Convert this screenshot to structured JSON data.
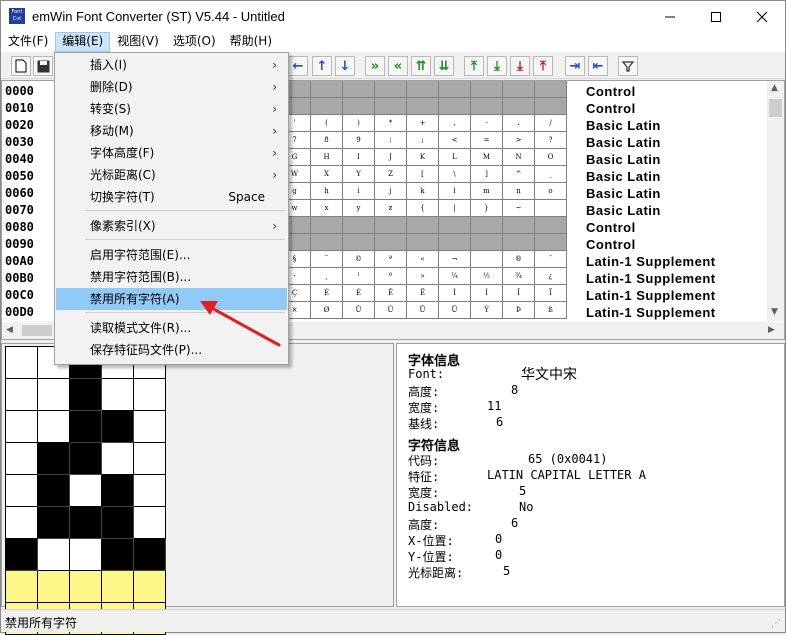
{
  "window": {
    "title": "emWin Font Converter (ST) V5.44 - Untitled",
    "icon_text": "Font Cvt"
  },
  "menubar": [
    "文件(F)",
    "编辑(E)",
    "视图(V)",
    "选项(O)",
    "帮助(H)"
  ],
  "dropdown": {
    "items": [
      {
        "label": "插入(I)",
        "submenu": true
      },
      {
        "label": "删除(D)",
        "submenu": true
      },
      {
        "label": "转变(S)",
        "submenu": true
      },
      {
        "label": "移动(M)",
        "submenu": true
      },
      {
        "label": "字体高度(F)",
        "submenu": true
      },
      {
        "label": "光标距离(C)",
        "submenu": true
      },
      {
        "label": "切换字符(T)",
        "shortcut": "Space"
      },
      {
        "label": "像素索引(X)",
        "submenu": true
      },
      {
        "label": "启用字符范围(E)..."
      },
      {
        "label": "禁用字符范围(B)..."
      },
      {
        "label": "禁用所有字符(A)",
        "highlighted": true
      },
      {
        "label": "读取模式文件(R)..."
      },
      {
        "label": "保存特征码文件(P)..."
      }
    ]
  },
  "grid": {
    "codes": [
      "0000",
      "0010",
      "0020",
      "0030",
      "0040",
      "0050",
      "0060",
      "0070",
      "0080",
      "0090",
      "00A0",
      "00B0",
      "00C0",
      "00D0"
    ],
    "ranges": [
      "Control",
      "Control",
      "Basic Latin",
      "Basic Latin",
      "Basic Latin",
      "Basic Latin",
      "Basic Latin",
      "Basic Latin",
      "Control",
      "Control",
      "Latin-1 Supplement",
      "Latin-1 Supplement",
      "Latin-1 Supplement",
      "Latin-1 Supplement"
    ],
    "rows": [
      {
        "gray": true,
        "cells": [
          "",
          "",
          "",
          "",
          "",
          "",
          "",
          "",
          ""
        ]
      },
      {
        "gray": true,
        "cells": [
          "",
          "",
          "",
          "",
          "",
          "",
          "",
          "",
          ""
        ]
      },
      {
        "gray": false,
        "cells": [
          "'",
          "(",
          ")",
          "*",
          "+",
          ",",
          "-",
          ".",
          "/"
        ]
      },
      {
        "gray": false,
        "cells": [
          "7",
          "8",
          "9",
          ":",
          ";",
          "<",
          "=",
          ">",
          "?"
        ]
      },
      {
        "gray": false,
        "cells": [
          "G",
          "H",
          "I",
          "J",
          "K",
          "L",
          "M",
          "N",
          "O"
        ]
      },
      {
        "gray": false,
        "cells": [
          "W",
          "X",
          "Y",
          "Z",
          "[",
          "\\",
          "]",
          "^",
          "_"
        ]
      },
      {
        "gray": false,
        "cells": [
          "g",
          "h",
          "i",
          "j",
          "k",
          "l",
          "m",
          "n",
          "o"
        ]
      },
      {
        "gray": false,
        "cells": [
          "w",
          "x",
          "y",
          "z",
          "{",
          "|",
          "}",
          "~",
          ""
        ]
      },
      {
        "gray": true,
        "cells": [
          "",
          "",
          "",
          "",
          "",
          "",
          "",
          "",
          ""
        ]
      },
      {
        "gray": true,
        "cells": [
          "",
          "",
          "",
          "",
          "",
          "",
          "",
          "",
          ""
        ]
      },
      {
        "gray": false,
        "cells": [
          "§",
          "¨",
          "©",
          "ª",
          "«",
          "¬",
          "",
          "®",
          "¯"
        ]
      },
      {
        "gray": false,
        "cells": [
          "·",
          "¸",
          "¹",
          "º",
          "»",
          "¼",
          "½",
          "¾",
          "¿"
        ]
      },
      {
        "gray": false,
        "cells": [
          "Ç",
          "È",
          "É",
          "Ê",
          "Ë",
          "Ì",
          "Í",
          "Î",
          "Ï"
        ]
      },
      {
        "gray": false,
        "cells": [
          "×",
          "Ø",
          "Ù",
          "Ú",
          "Û",
          "Ü",
          "Ý",
          "Þ",
          "ß"
        ]
      }
    ]
  },
  "pixel_editor": {
    "cols": 5,
    "pixels": [
      "w",
      "w",
      "b",
      "w",
      "w",
      "w",
      "w",
      "b",
      "w",
      "w",
      "w",
      "w",
      "b",
      "b",
      "w",
      "w",
      "b",
      "b",
      "w",
      "w",
      "w",
      "b",
      "w",
      "b",
      "w",
      "w",
      "b",
      "b",
      "b",
      "w",
      "b",
      "w",
      "w",
      "b",
      "b",
      "y",
      "y",
      "y",
      "y",
      "y",
      "y",
      "y",
      "y",
      "y",
      "y"
    ]
  },
  "font_info": {
    "section_title": "字体信息",
    "font_label": "Font:",
    "font_value": "华文中宋",
    "height_label": "高度:",
    "height_value": "8",
    "width_label": "宽度:",
    "width_value": "11",
    "baseline_label": "基线:",
    "baseline_value": "6"
  },
  "char_info": {
    "section_title": "字符信息",
    "code_label": "代码:",
    "code_value": "65 (0x0041)",
    "feature_label": "特征:",
    "feature_value": "LATIN CAPITAL LETTER A",
    "width_label": "宽度:",
    "width_value": "5",
    "disabled_label": "Disabled:",
    "disabled_value": "No",
    "height_label": "高度:",
    "height_value": "6",
    "xpos_label": "X-位置:",
    "xpos_value": "0",
    "ypos_label": "Y-位置:",
    "ypos_value": "0",
    "cursor_label": "光标距离:",
    "cursor_value": "5"
  },
  "status": {
    "text": "禁用所有字符"
  },
  "colors": {
    "highlight": "#91c9f7",
    "annotation_arrow": "#e02020",
    "pixel_fill_yellow": "#fff68a"
  }
}
